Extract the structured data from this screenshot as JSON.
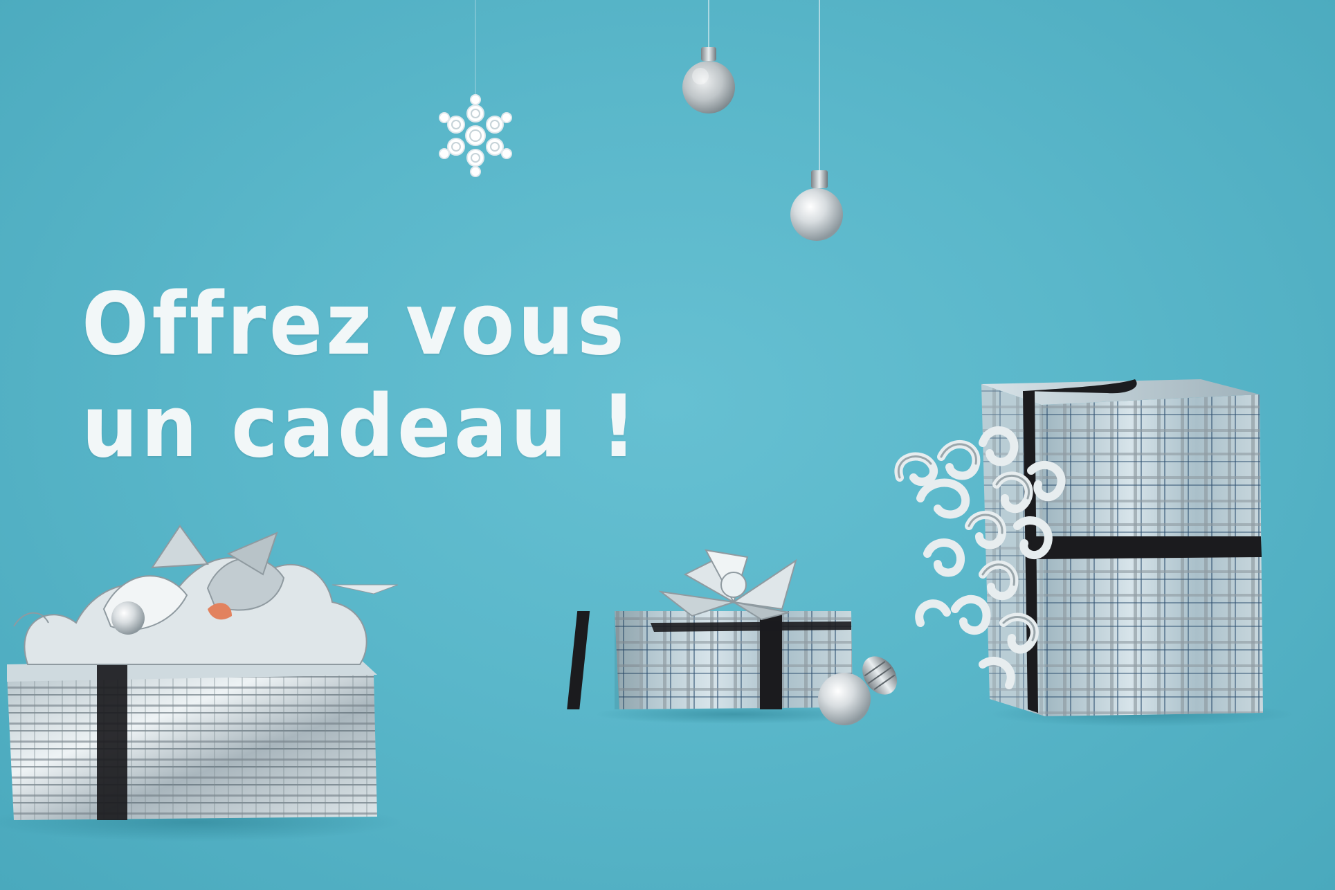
{
  "headline": {
    "line1": "Offrez vous",
    "line2": "un cadeau !"
  },
  "colors": {
    "background": "#5ab7ca",
    "text": "#f2f7f8",
    "silver": "#c9d3d8",
    "ribbon": "#1c1c1f"
  },
  "icons": {
    "snowflake": "snowflake-ornament",
    "ball": "christmas-ball-ornament"
  }
}
